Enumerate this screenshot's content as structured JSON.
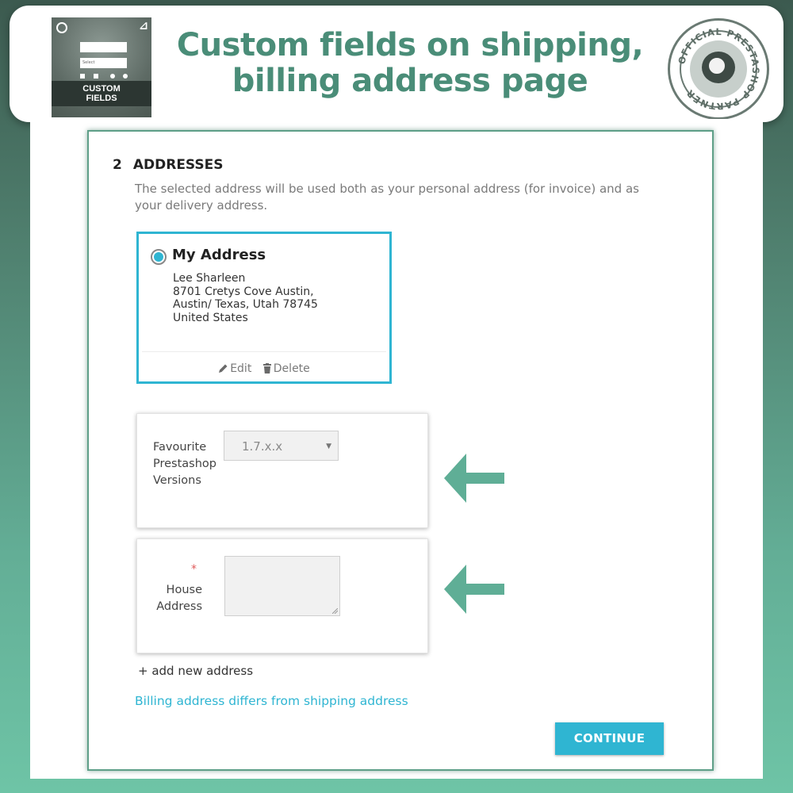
{
  "header": {
    "title_line1": "Custom fields on shipping,",
    "title_line2": "billing address page",
    "thumbnail": {
      "label_line1": "CUSTOM",
      "label_line2": "FIELDS",
      "select_placeholder": "Select"
    },
    "badge_text": "OFFICIAL PRESTASHOP PARTNER"
  },
  "checkout": {
    "step_number": "2",
    "step_title": "ADDRESSES",
    "description": "The selected address will be used both as your personal address (for invoice) and as your delivery address.",
    "address": {
      "alias": "My Address",
      "selected": true,
      "lines": [
        "Lee Sharleen",
        "8701 Cretys Cove Austin,",
        "Austin/ Texas, Utah 78745",
        "United States"
      ],
      "edit_label": "Edit",
      "delete_label": "Delete"
    },
    "custom_fields": {
      "versions_label_lines": [
        "Favourite",
        "Prestashop",
        "Versions"
      ],
      "versions_value": "1.7.x.x",
      "required_mark": "*",
      "house_label_lines": [
        "House",
        "Address"
      ]
    },
    "add_address_label": "+ add new address",
    "billing_link": "Billing address differs from shipping address",
    "continue_label": "CONTINUE"
  },
  "colors": {
    "accent": "#2fb5d2",
    "title": "#4a8d78",
    "arrow": "#5fae96"
  },
  "icons": [
    "pencil-icon",
    "trash-icon",
    "arrow-left-icon",
    "chevron-down-icon",
    "resize-handle-icon"
  ]
}
